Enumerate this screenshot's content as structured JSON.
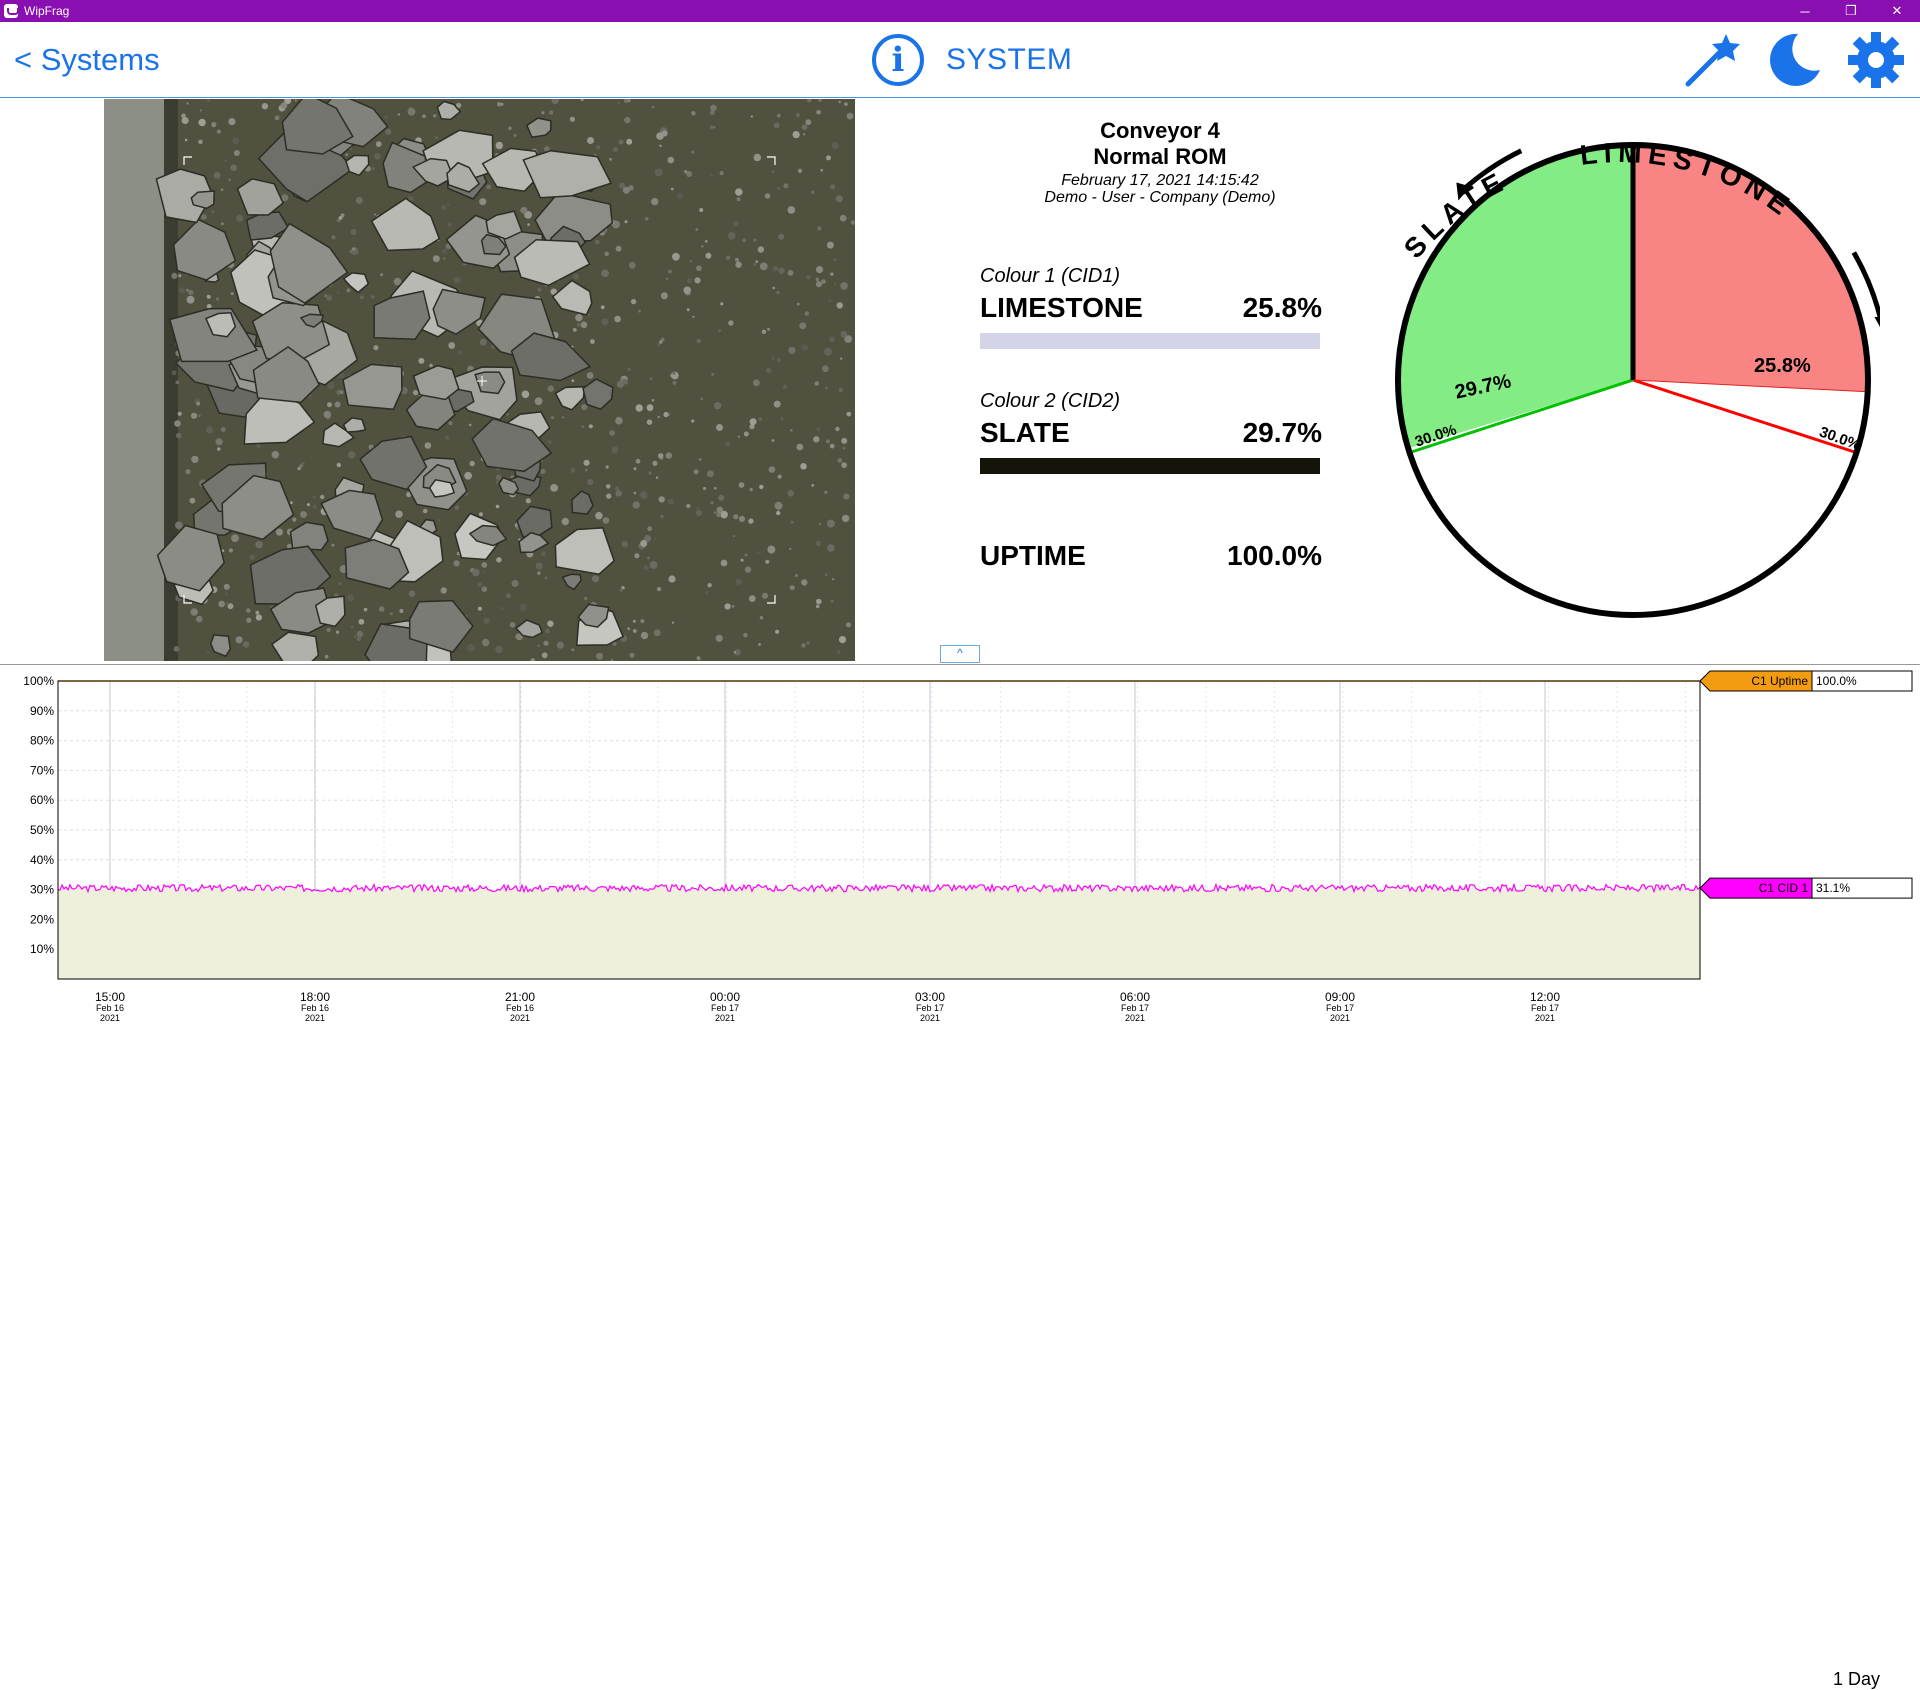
{
  "window": {
    "title": "WipFrag",
    "controls": [
      "─",
      "❐",
      "✕"
    ]
  },
  "header": {
    "back_label": "< Systems",
    "title": "SYSTEM",
    "icons": [
      "info-icon",
      "magic-wand-icon",
      "moon-icon",
      "gear-icon"
    ],
    "accent_color": "#1a73e8"
  },
  "conveyor": {
    "name": "Conveyor 4",
    "mode": "Normal ROM",
    "datetime": "February 17, 2021 14:15:42",
    "user": "Demo  -  User - Company (Demo)"
  },
  "metrics": {
    "colour1": {
      "label": "Colour 1 (CID1)",
      "name": "LIMESTONE",
      "value": "25.8%",
      "bar_color": "#d4d4e8"
    },
    "colour2": {
      "label": "Colour 2 (CID2)",
      "name": "SLATE",
      "value": "29.7%",
      "bar_color": "#15140a"
    },
    "uptime": {
      "name": "UPTIME",
      "value": "100.0%"
    }
  },
  "collapse_button": {
    "label": "^"
  },
  "gauge": {
    "labels": {
      "left": "SLATE",
      "right": "LIMESTONE"
    },
    "slices": [
      {
        "name": "LIMESTONE",
        "value": 25.8,
        "label": "25.8%",
        "color": "#f88484"
      },
      {
        "name": "SLATE",
        "value": 29.7,
        "label": "29.7%",
        "color": "#84ec84"
      }
    ],
    "thresholds": [
      {
        "label": "30.0%",
        "value": 30.0,
        "color": "#ff0000"
      },
      {
        "label": "30.0%",
        "value": 30.0,
        "color": "#00c000"
      }
    ]
  },
  "trend": {
    "range_label": "1 Day",
    "chart_data": {
      "type": "line",
      "y_ticks": [
        "100%",
        "90%",
        "80%",
        "70%",
        "60%",
        "50%",
        "40%",
        "30%",
        "20%",
        "10%"
      ],
      "ylim": [
        0,
        100
      ],
      "x_ticks": [
        {
          "time": "15:00",
          "date": "Feb 16",
          "year": "2021"
        },
        {
          "time": "18:00",
          "date": "Feb 16",
          "year": "2021"
        },
        {
          "time": "21:00",
          "date": "Feb 16",
          "year": "2021"
        },
        {
          "time": "00:00",
          "date": "Feb 17",
          "year": "2021"
        },
        {
          "time": "03:00",
          "date": "Feb 17",
          "year": "2021"
        },
        {
          "time": "06:00",
          "date": "Feb 17",
          "year": "2021"
        },
        {
          "time": "09:00",
          "date": "Feb 17",
          "year": "2021"
        },
        {
          "time": "12:00",
          "date": "Feb 17",
          "year": "2021"
        }
      ],
      "series": [
        {
          "name": "C1 Uptime",
          "value": "100.0%",
          "level": 100,
          "color": "#f39c12"
        },
        {
          "name": "C1 CID 1",
          "value": "31.1%",
          "level": 30.5,
          "color": "#ff00ff"
        }
      ],
      "fill_color": "#eef0dc"
    }
  }
}
